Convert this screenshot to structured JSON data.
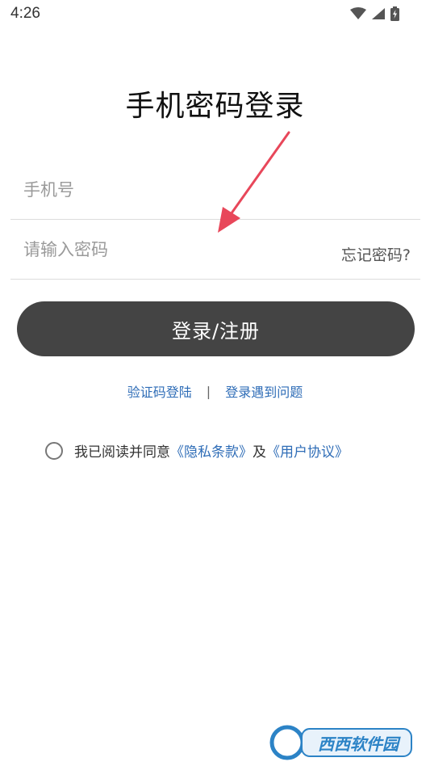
{
  "status_bar": {
    "time": "4:26",
    "icons": [
      "wifi-icon",
      "signal-icon",
      "battery-charging-icon"
    ]
  },
  "page_title": "手机密码登录",
  "form": {
    "phone_placeholder": "手机号",
    "password_placeholder": "请输入密码",
    "forgot_password": "忘记密码?"
  },
  "login_button": "登录/注册",
  "links": {
    "sms_login": "验证码登陆",
    "divider": "|",
    "login_problem": "登录遇到问题"
  },
  "agreement": {
    "prefix": "我已阅读并同意",
    "privacy": "《隐私条款》",
    "and": "及",
    "user_agreement": "《用户协议》"
  },
  "watermark_text": "西西软件园",
  "colors": {
    "button_bg": "#444444",
    "link": "#2f6db7",
    "arrow": "#e8475a"
  }
}
